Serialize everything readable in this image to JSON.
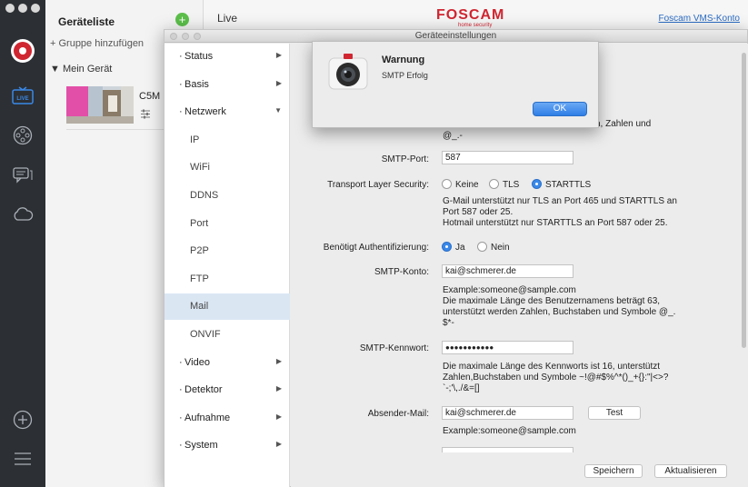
{
  "sidebar": {
    "traffic_lights": [
      "close",
      "minimize",
      "zoom"
    ],
    "icons": [
      "foscam-logo-icon",
      "live-icon",
      "playback-icon",
      "message-icon",
      "cloud-icon",
      "add-icon",
      "menu-icon"
    ],
    "live_badge": "LIVE"
  },
  "device_panel": {
    "title": "Geräteliste",
    "add_group": "+ Gruppe hinzufügen",
    "my_device": "Mein Gerät",
    "camera_name": "C5M"
  },
  "header": {
    "tab": "Live",
    "brand": "FOSCAM",
    "brand_sub": "home security",
    "account_link": "Foscam VMS-Konto"
  },
  "window": {
    "title": "Geräteeinstellungen"
  },
  "nav": {
    "items": [
      {
        "label": "Status",
        "level": "top",
        "arrow": "▶"
      },
      {
        "label": "Basis",
        "level": "top",
        "arrow": "▶"
      },
      {
        "label": "Netzwerk",
        "level": "top",
        "arrow": "▼"
      },
      {
        "label": "IP",
        "level": "sub"
      },
      {
        "label": "WiFi",
        "level": "sub"
      },
      {
        "label": "DDNS",
        "level": "sub"
      },
      {
        "label": "Port",
        "level": "sub"
      },
      {
        "label": "P2P",
        "level": "sub"
      },
      {
        "label": "FTP",
        "level": "sub"
      },
      {
        "label": "Mail",
        "level": "sub",
        "active": true
      },
      {
        "label": "ONVIF",
        "level": "sub"
      },
      {
        "label": "Video",
        "level": "top",
        "arrow": "▶"
      },
      {
        "label": "Detektor",
        "level": "top",
        "arrow": "▶"
      },
      {
        "label": "Aufnahme",
        "level": "top",
        "arrow": "▶"
      },
      {
        "label": "System",
        "level": "top",
        "arrow": "▶"
      }
    ]
  },
  "form": {
    "top_note_line1": "ch, Zahlen und",
    "top_note_line2": "@_.-",
    "smtp_port_label": "SMTP-Port:",
    "smtp_port_value": "587",
    "tls_label": "Transport Layer Security:",
    "tls_options": [
      "Keine",
      "TLS",
      "STARTTLS"
    ],
    "tls_selected": "STARTTLS",
    "tls_note_line1": "G-Mail unterstützt nur TLS an Port 465 und STARTTLS an",
    "tls_note_line2": "Port 587 oder 25.",
    "tls_note_line3": "Hotmail unterstützt nur STARTTLS an Port 587 oder 25.",
    "auth_label": "Benötigt Authentifizierung:",
    "auth_options": [
      "Ja",
      "Nein"
    ],
    "auth_selected": "Ja",
    "account_label": "SMTP-Konto:",
    "account_value": "kai@schmerer.de",
    "account_note_line1": "Example:someone@sample.com",
    "account_note_line2": "Die maximale Länge des Benutzernamens beträgt 63,",
    "account_note_line3": "unterstützt werden Zahlen, Buchstaben und Symbole @_.",
    "account_note_line4": "$*-",
    "password_label": "SMTP-Kennwort:",
    "password_value": "●●●●●●●●●●●",
    "password_note_line1": "Die maximale Länge des Kennworts ist 16, unterstützt",
    "password_note_line2": "Zahlen,Buchstaben und Symbole ~!@#$%^*()_+{}:\"|<>?",
    "password_note_line3": "`-;'\\,./&=[]",
    "sender_label": "Absender-Mail:",
    "sender_value": "kai@schmerer.de",
    "test_button": "Test",
    "sender_note": "Example:someone@sample.com",
    "save_button": "Speichern",
    "refresh_button": "Aktualisieren"
  },
  "dialog": {
    "title": "Warnung",
    "message": "SMTP Erfolg",
    "ok": "OK"
  },
  "colors": {
    "brand_red": "#d02631",
    "accent_blue": "#2f7ee6",
    "nav_active": "#dbe6f3",
    "rail": "#2c2f33"
  }
}
